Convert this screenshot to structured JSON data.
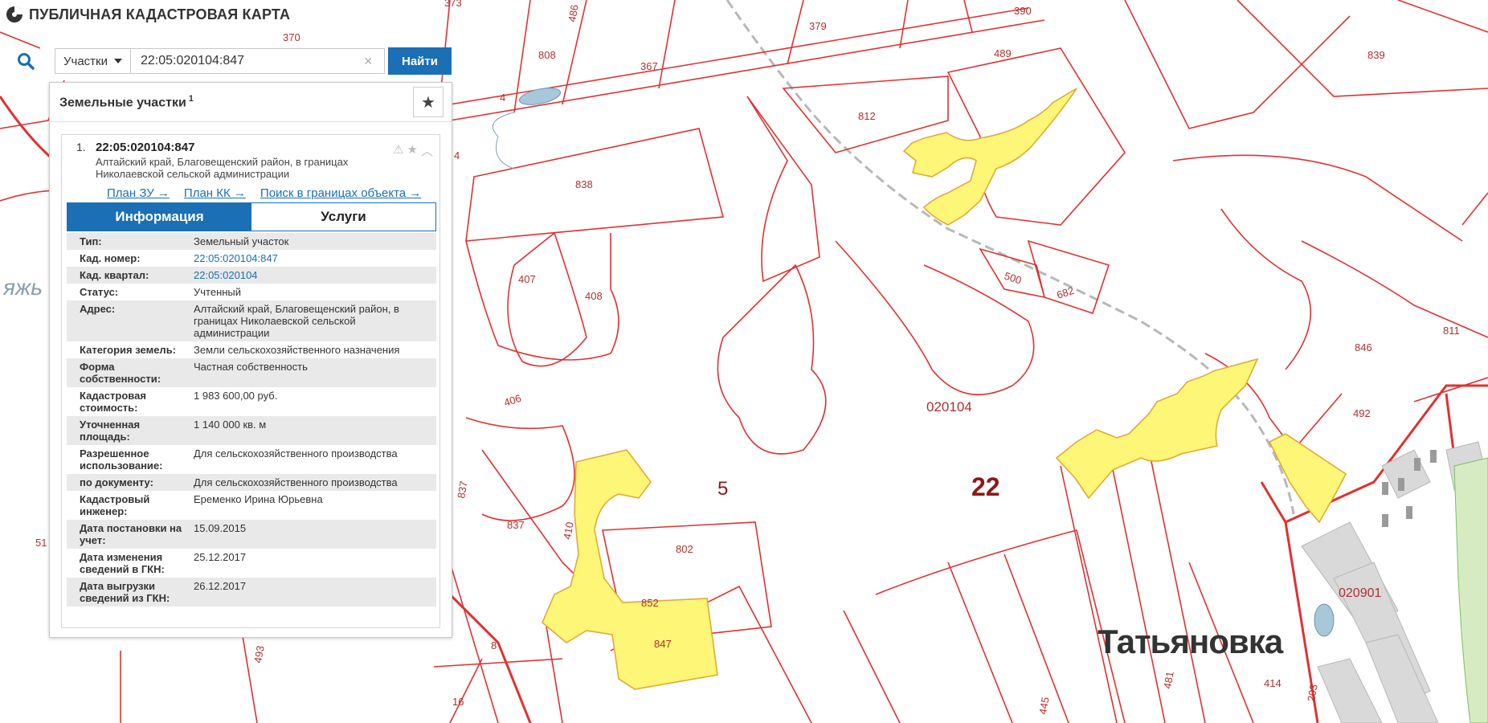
{
  "app": {
    "title": "ПУБЛИЧНАЯ КАДАСТРОВАЯ КАРТА"
  },
  "search": {
    "type_label": "Участки",
    "query": "22:05:020104:847",
    "find_label": "Найти"
  },
  "panel": {
    "title": "Земельные участки",
    "count": "1"
  },
  "result": {
    "number": "1.",
    "cad_number": "22:05:020104:847",
    "address": "Алтайский край, Благовещенский район, в границах Николаевской сельской администрации",
    "links": {
      "plan_zu": "План ЗУ →",
      "plan_kk": "План КК →",
      "search_within": "Поиск в границах объекта →"
    },
    "tabs": {
      "info": "Информация",
      "services": "Услуги"
    },
    "rows": [
      {
        "k": "Тип:",
        "v": "Земельный участок"
      },
      {
        "k": "Кад. номер:",
        "v": "22:05:020104:847"
      },
      {
        "k": "Кад. квартал:",
        "v": "22:05:020104"
      },
      {
        "k": "Статус:",
        "v": "Учтенный"
      },
      {
        "k": "Адрес:",
        "v": "Алтайский край, Благовещенский район, в границах Николаевской сельской администрации"
      },
      {
        "k": "Категория земель:",
        "v": "Земли сельскохозяйственного назначения"
      },
      {
        "k": "Форма собственности:",
        "v": "Частная собственность"
      },
      {
        "k": "Кадастровая стоимость:",
        "v": "1 983 600,00 руб."
      },
      {
        "k": "Уточненная площадь:",
        "v": "1 140 000 кв. м"
      },
      {
        "k": "Разрешенное использование:",
        "v": "Для сельскохозяйственного производства"
      },
      {
        "k": "по документу:",
        "v": "Для сельскохозяйственного производства"
      },
      {
        "k": "Кадастровый инженер:",
        "v": "Еременко Ирина Юрьевна"
      },
      {
        "k": "Дата постановки на учет:",
        "v": "15.09.2015"
      },
      {
        "k": "Дата изменения сведений в ГКН:",
        "v": "25.12.2017"
      },
      {
        "k": "Дата выгрузки сведений из ГКН:",
        "v": "26.12.2017"
      }
    ]
  },
  "map": {
    "labels": {
      "quarter_main": "020104",
      "quarter_east": "020901",
      "region": "22",
      "district": "5",
      "town": "Татьяновка",
      "partial_left": "яжь",
      "p373": "373",
      "p486": "486",
      "p379": "379",
      "p390": "390",
      "p839": "839",
      "p808": "808",
      "p367": "367",
      "p489": "489",
      "p812": "812",
      "p838": "838",
      "p407": "407",
      "p408": "408",
      "p500": "500",
      "p682": "682",
      "p811": "811",
      "p846": "846",
      "p492": "492",
      "p406": "406",
      "p837": "837",
      "p837b": "837",
      "p410": "410",
      "p802": "802",
      "p852": "852",
      "p847": "847",
      "p493": "493",
      "p16": "16",
      "p8": "8",
      "p445": "445",
      "p481": "481",
      "p414": "414",
      "p203": "203",
      "p51": "51",
      "p4": "4",
      "p4b": "4",
      "p370": "370"
    },
    "colors": {
      "boundary": "#e23030",
      "selected_fill": "#fdf676",
      "plot_label": "#b03030"
    }
  }
}
